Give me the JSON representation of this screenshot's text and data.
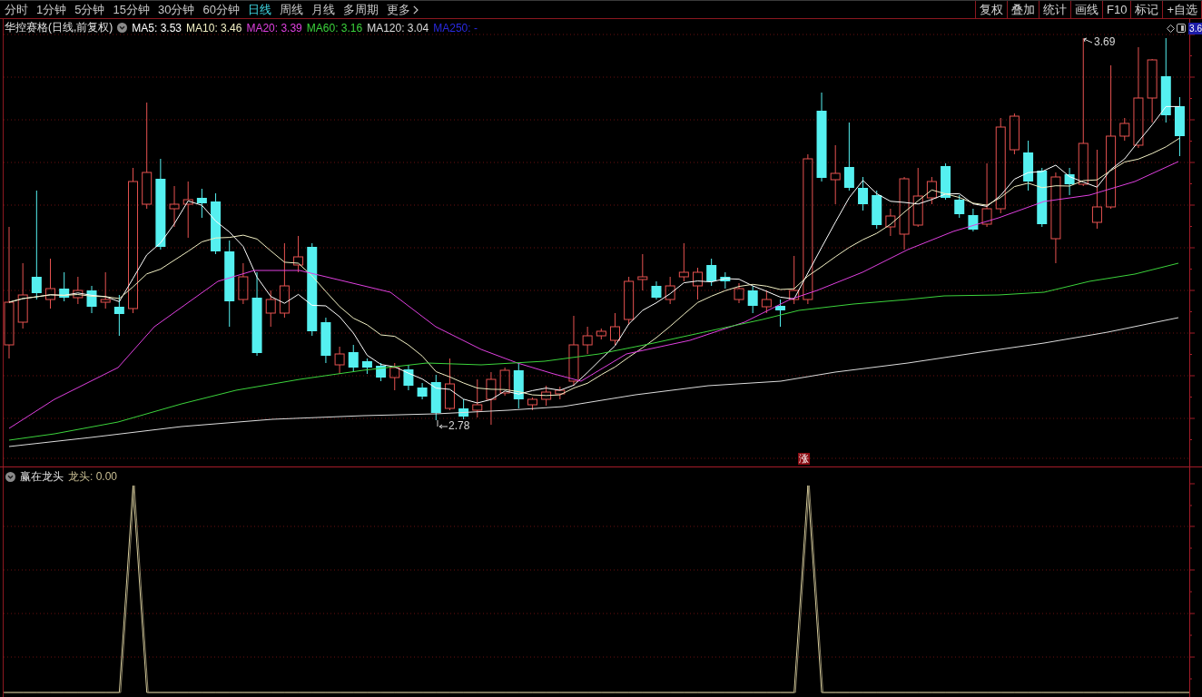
{
  "toolbar": {
    "periods": [
      {
        "label": "分时",
        "selected": false
      },
      {
        "label": "1分钟",
        "selected": false
      },
      {
        "label": "5分钟",
        "selected": false
      },
      {
        "label": "15分钟",
        "selected": false
      },
      {
        "label": "30分钟",
        "selected": false
      },
      {
        "label": "60分钟",
        "selected": false
      },
      {
        "label": "日线",
        "selected": true
      },
      {
        "label": "周线",
        "selected": false
      },
      {
        "label": "月线",
        "selected": false
      },
      {
        "label": "多周期",
        "selected": false
      }
    ],
    "more_menu": {
      "label": "更多"
    },
    "tools": [
      "复权",
      "叠加",
      "统计",
      "画线",
      "F10",
      "标记",
      "+自选"
    ]
  },
  "price_chart": {
    "title": "华控赛格(日线,前复权)",
    "moving_averages": [
      {
        "label": "MA5: 3.53",
        "color": "#ffffff"
      },
      {
        "label": "MA10: 3.46",
        "color": "#f2f0c4"
      },
      {
        "label": "MA20: 3.39",
        "color": "#e040e0"
      },
      {
        "label": "MA60: 3.16",
        "color": "#3cd43c"
      },
      {
        "label": "MA120: 3.04",
        "color": "#dcdcdc"
      },
      {
        "label": "MA250: -",
        "color": "#2a2ae0"
      }
    ],
    "high_label": "3.69",
    "low_label": "2.78",
    "signal_tag": "涨",
    "price_tag": "3.6"
  },
  "indicator_panel": {
    "name": "赢在龙头",
    "reading": "龙头: 0.00"
  }
}
